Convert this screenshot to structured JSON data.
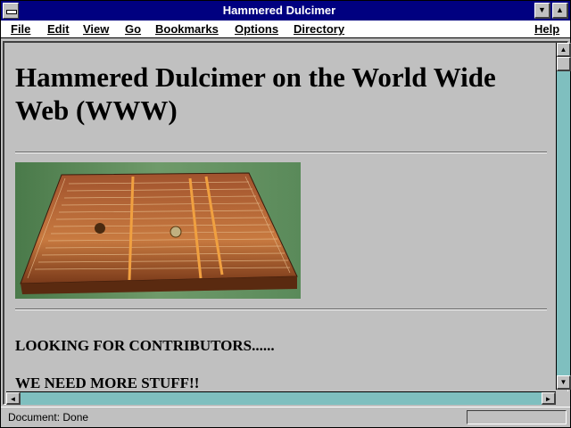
{
  "window": {
    "title": "Hammered Dulcimer"
  },
  "icons": {
    "system_menu": "system-menu-icon",
    "minimize": "minimize-icon",
    "maximize": "maximize-icon",
    "scroll_up": "arrow-up-icon",
    "scroll_down": "arrow-down-icon",
    "scroll_left": "arrow-left-icon",
    "scroll_right": "arrow-right-icon"
  },
  "menubar": {
    "items": [
      "File",
      "Edit",
      "View",
      "Go",
      "Bookmarks",
      "Options",
      "Directory",
      "Help"
    ]
  },
  "page": {
    "heading": "Hammered Dulcimer on the World Wide Web (WWW)",
    "lines": [
      "LOOKING FOR CONTRIBUTORS......",
      "WE NEED MORE STUFF!!"
    ]
  },
  "status": {
    "text": "Document: Done"
  },
  "colors": {
    "titlebar": "#000080",
    "window_bg": "#c0c0c0",
    "scroll_track": "#7fbfbf"
  }
}
